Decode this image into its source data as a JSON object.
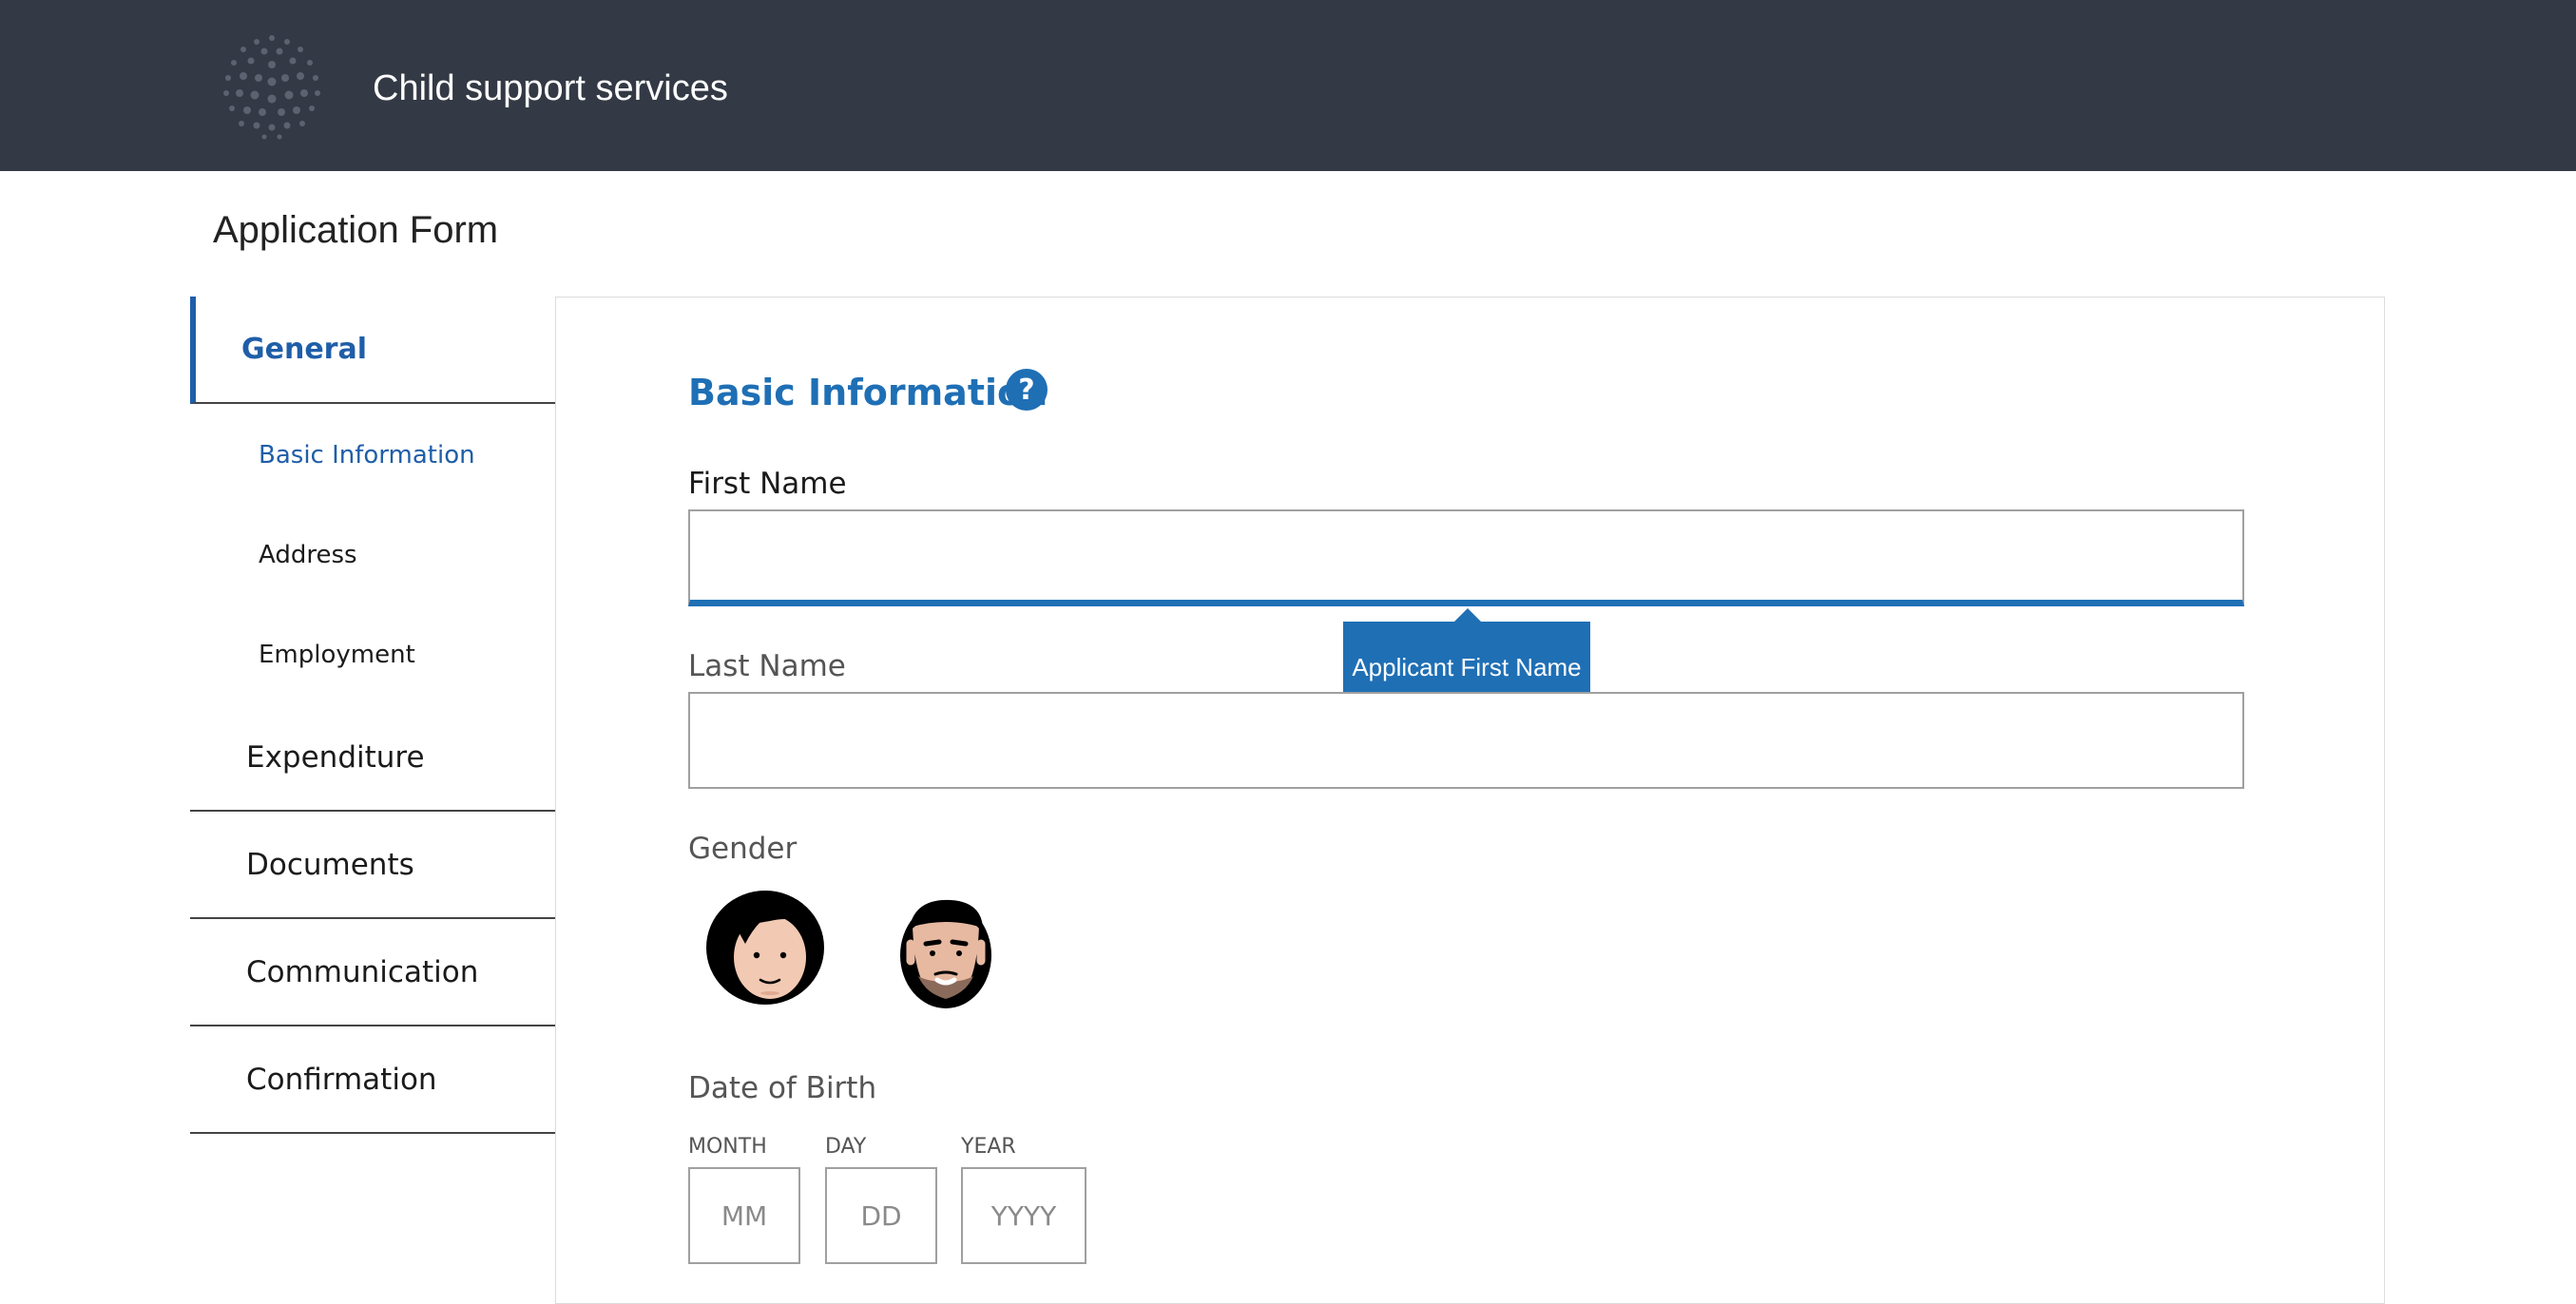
{
  "header": {
    "app_title": "Child support services",
    "logo_icon": "dotted-globe-logo-icon"
  },
  "page": {
    "title": "Application Form"
  },
  "nav": {
    "general": "General",
    "subitems": [
      {
        "label": "Basic Information",
        "active": true
      },
      {
        "label": "Address",
        "active": false
      },
      {
        "label": "Employment",
        "active": false
      }
    ],
    "items": [
      {
        "label": "Expenditure"
      },
      {
        "label": "Documents"
      },
      {
        "label": "Communication"
      },
      {
        "label": "Confirmation"
      }
    ]
  },
  "form": {
    "section_title": "Basic Information",
    "help_icon": "?",
    "first_name": {
      "label": "First Name",
      "value": "",
      "placeholder": ""
    },
    "tooltip": "Applicant First Name",
    "last_name": {
      "label": "Last Name",
      "value": "",
      "placeholder": ""
    },
    "gender": {
      "label": "Gender",
      "options": [
        "female-avatar-icon",
        "male-avatar-icon"
      ]
    },
    "dob": {
      "label": "Date of Birth",
      "month_label": "MONTH",
      "month_placeholder": "MM",
      "day_label": "DAY",
      "day_placeholder": "DD",
      "year_label": "YEAR",
      "year_placeholder": "YYYY"
    }
  },
  "colors": {
    "header_bg": "#333a45",
    "accent": "#1f6fb5",
    "nav_active": "#1f5ea8"
  }
}
